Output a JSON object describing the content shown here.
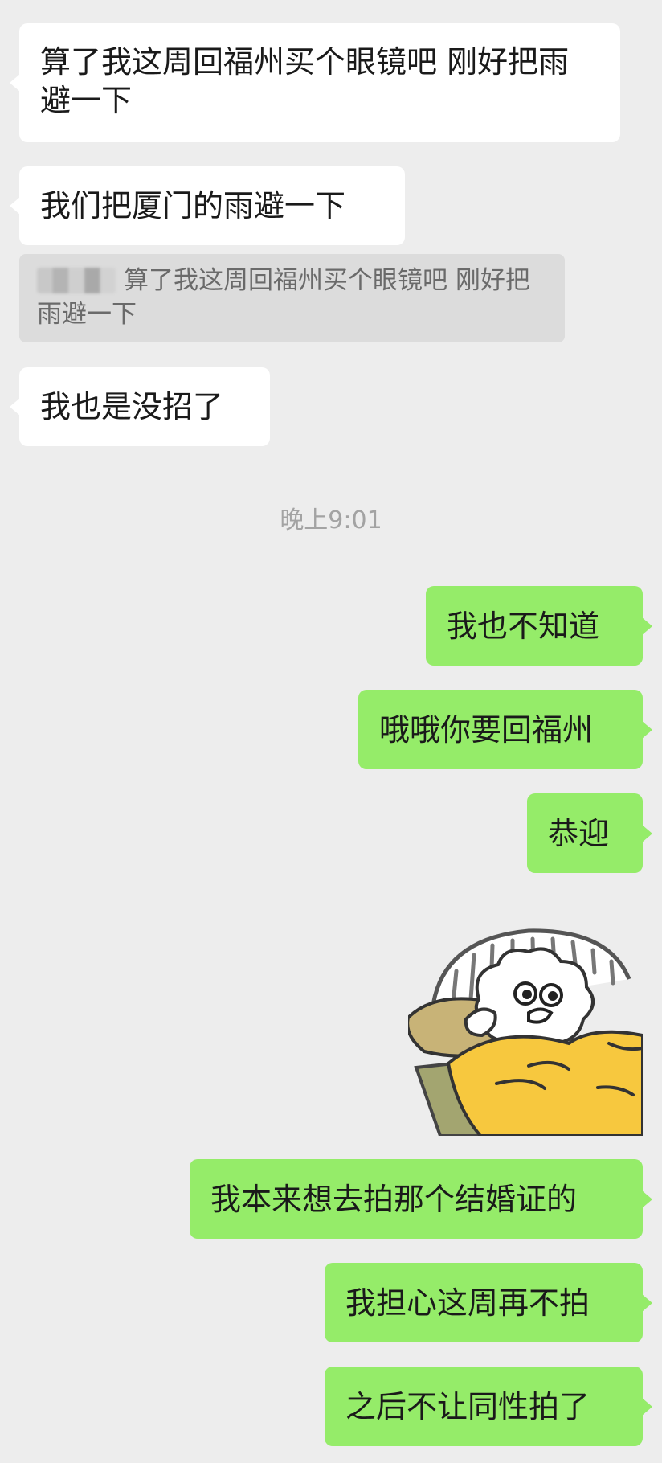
{
  "messages_top": [
    {
      "id": "m1",
      "side": "left",
      "text": "算了我这周回福州买个眼镜吧 刚好把雨避一下"
    },
    {
      "id": "m2",
      "side": "left",
      "text": "我们把厦门的雨避一下"
    },
    {
      "id": "m3",
      "side": "left",
      "text": "我也是没招了"
    }
  ],
  "quote": {
    "sender": "",
    "text": "算了我这周回福州买个眼镜吧 刚好把雨避一下"
  },
  "timestamp": "晚上9:01",
  "messages_bottom": [
    {
      "id": "m4",
      "side": "right",
      "text": "我也不知道"
    },
    {
      "id": "m5",
      "side": "right",
      "text": "哦哦你要回福州"
    },
    {
      "id": "m6",
      "side": "right",
      "text": "恭迎"
    },
    {
      "id": "m8",
      "side": "right",
      "text": "我本来想去拍那个结婚证的"
    },
    {
      "id": "m9",
      "side": "right",
      "text": "我担心这周再不拍"
    },
    {
      "id": "m10",
      "side": "right",
      "text": "之后不让同性拍了"
    }
  ],
  "sticker": {
    "icon": "sleepy-cartoon-sticker",
    "colors": {
      "blanket": "#f7c83e",
      "pillow": "#c8b377",
      "bed": "#a3a570",
      "frame": "#555555"
    }
  },
  "colors": {
    "background": "#ededed",
    "bubble_left": "#ffffff",
    "bubble_right": "#95ec69",
    "quote_bg": "#dcdcdc",
    "timestamp": "#a3a3a3"
  }
}
